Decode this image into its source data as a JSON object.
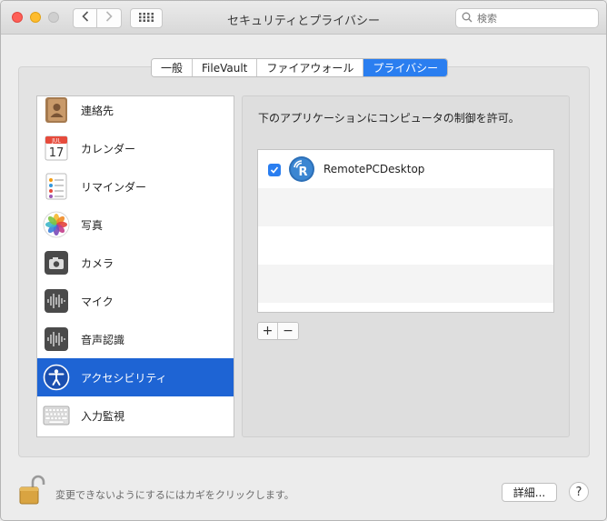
{
  "window": {
    "title": "セキュリティとプライバシー"
  },
  "toolbar": {
    "back_icon": "chevron-left-icon",
    "forward_icon": "chevron-right-icon",
    "show_all_icon": "grid-icon"
  },
  "search": {
    "placeholder": "検索"
  },
  "tabs": [
    {
      "label": "一般",
      "active": false
    },
    {
      "label": "FileVault",
      "active": false
    },
    {
      "label": "ファイアウォール",
      "active": false
    },
    {
      "label": "プライバシー",
      "active": true
    }
  ],
  "sidebar": {
    "items": [
      {
        "label": "連絡先",
        "icon": "contacts-icon",
        "selected": false
      },
      {
        "label": "カレンダー",
        "icon": "calendar-icon",
        "selected": false
      },
      {
        "label": "リマインダー",
        "icon": "reminders-icon",
        "selected": false
      },
      {
        "label": "写真",
        "icon": "photos-icon",
        "selected": false
      },
      {
        "label": "カメラ",
        "icon": "camera-icon",
        "selected": false
      },
      {
        "label": "マイク",
        "icon": "microphone-icon",
        "selected": false
      },
      {
        "label": "音声認識",
        "icon": "speech-recognition-icon",
        "selected": false
      },
      {
        "label": "アクセシビリティ",
        "icon": "accessibility-icon",
        "selected": true
      },
      {
        "label": "入力監視",
        "icon": "keyboard-icon",
        "selected": false
      }
    ],
    "calendar_month": "JUL",
    "calendar_day": "17"
  },
  "main": {
    "heading": "下のアプリケーションにコンピュータの制御を許可。",
    "apps": [
      {
        "name": "RemotePCDesktop",
        "checked": true,
        "icon": "remotepc-icon"
      }
    ],
    "add_label": "+",
    "remove_label": "−"
  },
  "footer": {
    "lock_text": "変更できないようにするにはカギをクリックします。",
    "advanced_label": "詳細...",
    "help_label": "?"
  },
  "colors": {
    "accent": "#2a7ef0",
    "selection": "#1e64d4"
  }
}
